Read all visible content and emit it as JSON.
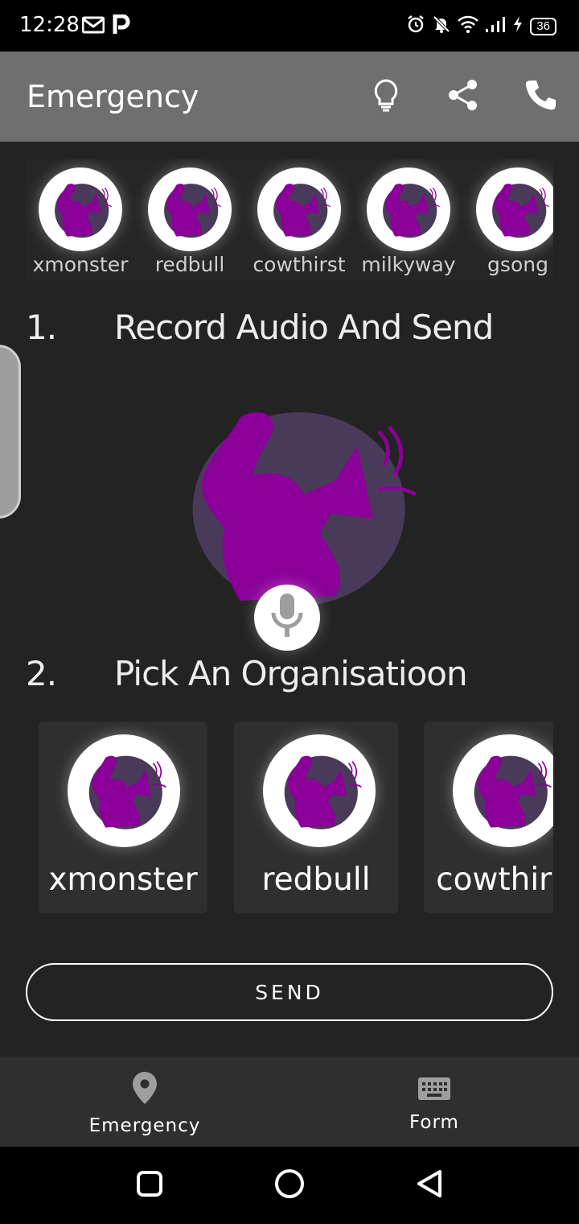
{
  "status_bar": {
    "time": "12:28",
    "battery": "36",
    "icons": [
      "gmail-icon",
      "parking-icon",
      "alarm-icon",
      "mute-icon",
      "wifi-icon",
      "signal-icon",
      "charging-icon",
      "battery-icon"
    ]
  },
  "app_bar": {
    "title": "Emergency",
    "actions": [
      "lightbulb-icon",
      "share-icon",
      "phone-icon"
    ]
  },
  "top_orgs": [
    {
      "label": "xmonster"
    },
    {
      "label": "redbull"
    },
    {
      "label": "cowthirst"
    },
    {
      "label": "milkyway"
    },
    {
      "label": "gsong"
    }
  ],
  "step1": {
    "number": "1.",
    "title": "Record Audio And Send"
  },
  "step2": {
    "number": "2.",
    "title": "Pick An Organisatioon"
  },
  "org_cards": [
    {
      "label": "xmonster"
    },
    {
      "label": "redbull"
    },
    {
      "label": "cowthirst"
    }
  ],
  "send_label": "SEND",
  "bottom_nav": [
    {
      "label": "Emergency",
      "icon": "location-pin-icon"
    },
    {
      "label": "Form",
      "icon": "keyboard-icon"
    }
  ],
  "colors": {
    "accent_purple": "#8b0099",
    "hero_circle": "#4a3a5a",
    "background": "#232323",
    "app_bar": "#6f6f6f"
  }
}
